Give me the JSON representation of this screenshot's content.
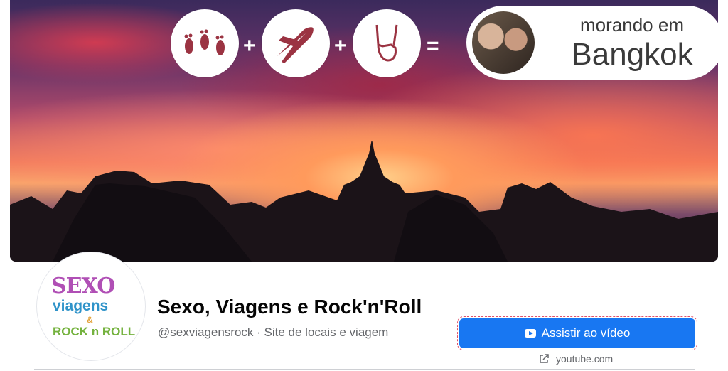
{
  "cover": {
    "title_line1": "morando em",
    "title_line2": "Bangkok",
    "plus1": "+",
    "plus2": "+",
    "equals": "=",
    "icons": [
      "footprints-icon",
      "airplane-icon",
      "rock-hand-icon"
    ]
  },
  "page": {
    "name": "Sexo, Viagens e Rock'n'Roll",
    "handle_category": "@sexviagensrock · Site de locais e viagem",
    "logo": {
      "word1": "SEXO",
      "word2": "viagens",
      "word3": "&",
      "word4": "ROCK n ROLL"
    }
  },
  "cta": {
    "label": "Assistir ao vídeo",
    "link_text": "youtube.com",
    "color": "#1877f2"
  }
}
